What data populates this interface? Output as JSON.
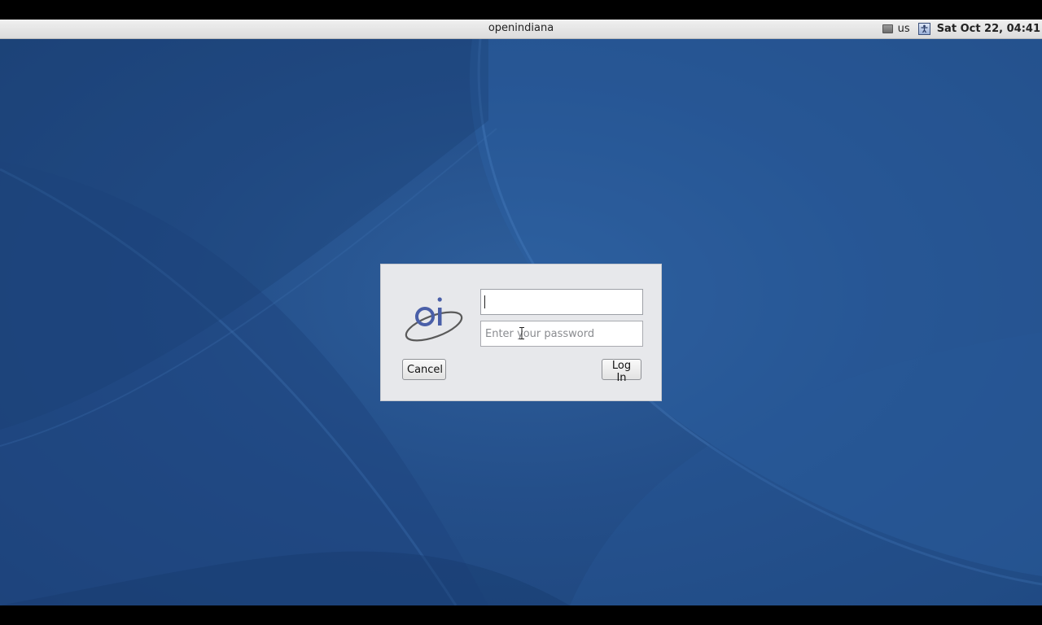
{
  "topbar": {
    "hostname": "openindiana",
    "keyboard_layout": "us",
    "clock": "Sat Oct 22, 04:41",
    "icons": [
      "display-icon",
      "accessibility-icon"
    ]
  },
  "login": {
    "logo": "oi",
    "username_value": "",
    "password_placeholder": "Enter your password",
    "cancel_label": "Cancel",
    "login_label": "Log In"
  },
  "colors": {
    "desktop": "#244f8a",
    "dialog": "#e7e8eb",
    "topbar": "#e6e6e6"
  }
}
